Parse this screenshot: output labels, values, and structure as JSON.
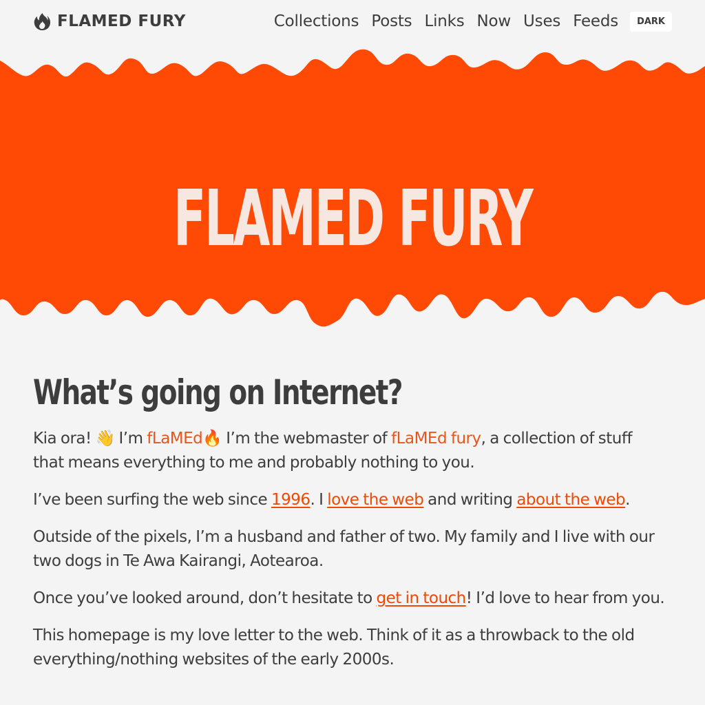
{
  "header": {
    "brand": "FLAMED FURY",
    "nav": [
      "Collections",
      "Posts",
      "Links",
      "Now",
      "Uses",
      "Feeds"
    ],
    "theme_toggle": "DARK"
  },
  "hero": {
    "title": "FLAMED FURY"
  },
  "main": {
    "heading": "What’s going on Internet?",
    "p1": {
      "a": "Kia ora! 👋 I’m ",
      "name": "fLaMEd",
      "b": "🔥 I’m the webmaster of ",
      "site": "fLaMEd fury",
      "c": ", a collection of stuff that means everything to me and probably nothing to you."
    },
    "p2": {
      "a": "I’ve been surfing the web since ",
      "link1": "1996",
      "b": ". I ",
      "link2": "love the web",
      "c": " and writing ",
      "link3": "about the web",
      "d": "."
    },
    "p3": "Outside of the pixels, I’m a husband and father of two. My family and I live with our two dogs in Te Awa Kairangi, Aotearoa.",
    "p4": {
      "a": "Once you’ve looked around, don’t hesitate to ",
      "link": "get in touch",
      "b": "! I’d love to hear from you."
    },
    "p5": "This homepage is my love letter to the web. Think of it as a throwback to the old everything/nothing websites of the early 2000s."
  },
  "colors": {
    "background": "#f4f4f4",
    "accent": "#ff4a06",
    "text": "#3d3d3d",
    "hero_title": "#f6e7e0",
    "link": "#ee4a06"
  },
  "icons": {
    "brand": "flame-icon"
  }
}
